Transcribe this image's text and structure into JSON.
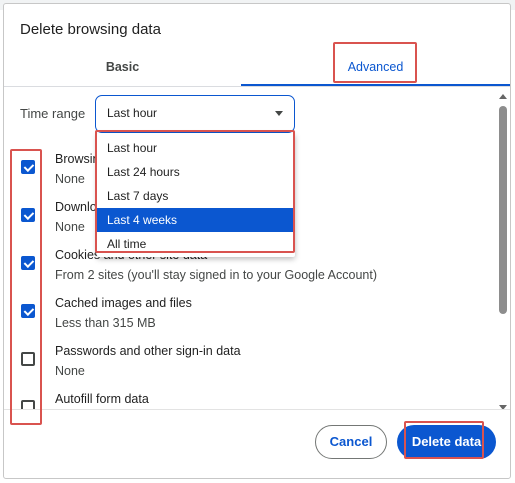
{
  "dialog": {
    "title": "Delete browsing data",
    "tabs": [
      {
        "label": "Basic",
        "selected": false
      },
      {
        "label": "Advanced",
        "selected": true
      }
    ]
  },
  "time_range": {
    "label": "Time range",
    "value": "Last hour",
    "options": [
      {
        "label": "Last hour",
        "selected": false
      },
      {
        "label": "Last 24 hours",
        "selected": false
      },
      {
        "label": "Last 7 days",
        "selected": false
      },
      {
        "label": "Last 4 weeks",
        "selected": true
      },
      {
        "label": "All time",
        "selected": false
      }
    ]
  },
  "items": [
    {
      "title": "Browsing history",
      "subtitle": "None",
      "checked": true
    },
    {
      "title": "Download history",
      "subtitle": "None",
      "checked": true
    },
    {
      "title": "Cookies and other site data",
      "subtitle": "From 2 sites (you'll stay signed in to your Google Account)",
      "checked": true
    },
    {
      "title": "Cached images and files",
      "subtitle": "Less than 315 MB",
      "checked": true
    },
    {
      "title": "Passwords and other sign-in data",
      "subtitle": "None",
      "checked": false
    },
    {
      "title": "Autofill form data",
      "subtitle": "",
      "checked": false
    }
  ],
  "buttons": {
    "cancel": "Cancel",
    "delete": "Delete data"
  },
  "colors": {
    "accent": "#0b57d0",
    "highlight": "#d9534f",
    "text": "#1f1f1f",
    "secondary_text": "#444746"
  }
}
